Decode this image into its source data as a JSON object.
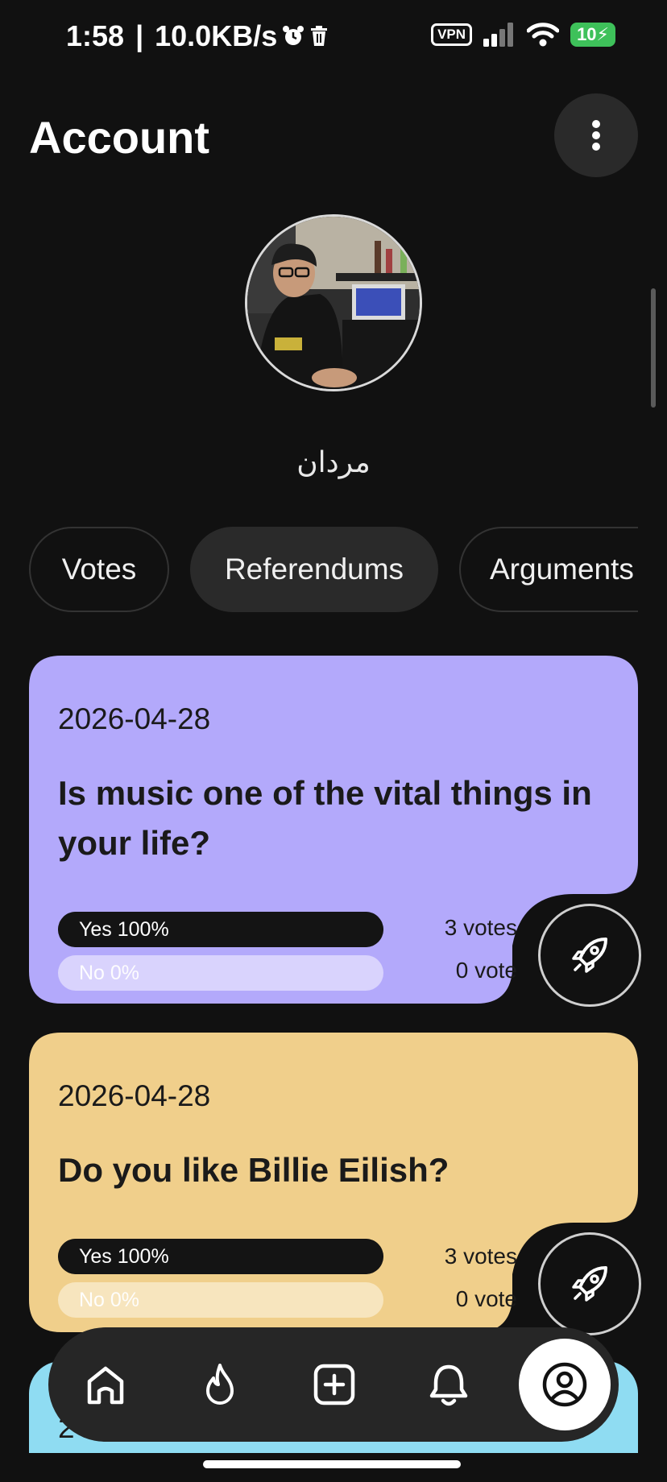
{
  "status_bar": {
    "time": "1:58",
    "network_speed": "10.0KB/s",
    "vpn": "VPN",
    "battery": "10"
  },
  "header": {
    "title": "Account"
  },
  "profile": {
    "username": "مردان"
  },
  "tabs": [
    {
      "label": "Votes",
      "active": false
    },
    {
      "label": "Referendums",
      "active": true
    },
    {
      "label": "Arguments",
      "active": false
    }
  ],
  "referendums": [
    {
      "date": "2026-04-28",
      "question": "Is music one of the vital things in your life?",
      "color": "#b3a9fb",
      "yes_label": "Yes 100%",
      "no_label": "No 0%",
      "yes_fraction": 1.0,
      "yes_votes": "3 votes",
      "no_votes": "0 vote"
    },
    {
      "date": "2026-04-28",
      "question": "Do you like Billie Eilish?",
      "color": "#f0cf8b",
      "yes_label": "Yes 100%",
      "no_label": "No 0%",
      "yes_fraction": 1.0,
      "yes_votes": "3 votes",
      "no_votes": "0 vote"
    },
    {
      "date": "2",
      "color": "#8fdcf2"
    }
  ],
  "bottom_nav": [
    {
      "icon": "home-icon",
      "active": false
    },
    {
      "icon": "flame-icon",
      "active": false
    },
    {
      "icon": "add-icon",
      "active": false
    },
    {
      "icon": "bell-icon",
      "active": false
    },
    {
      "icon": "profile-icon",
      "active": true
    }
  ]
}
